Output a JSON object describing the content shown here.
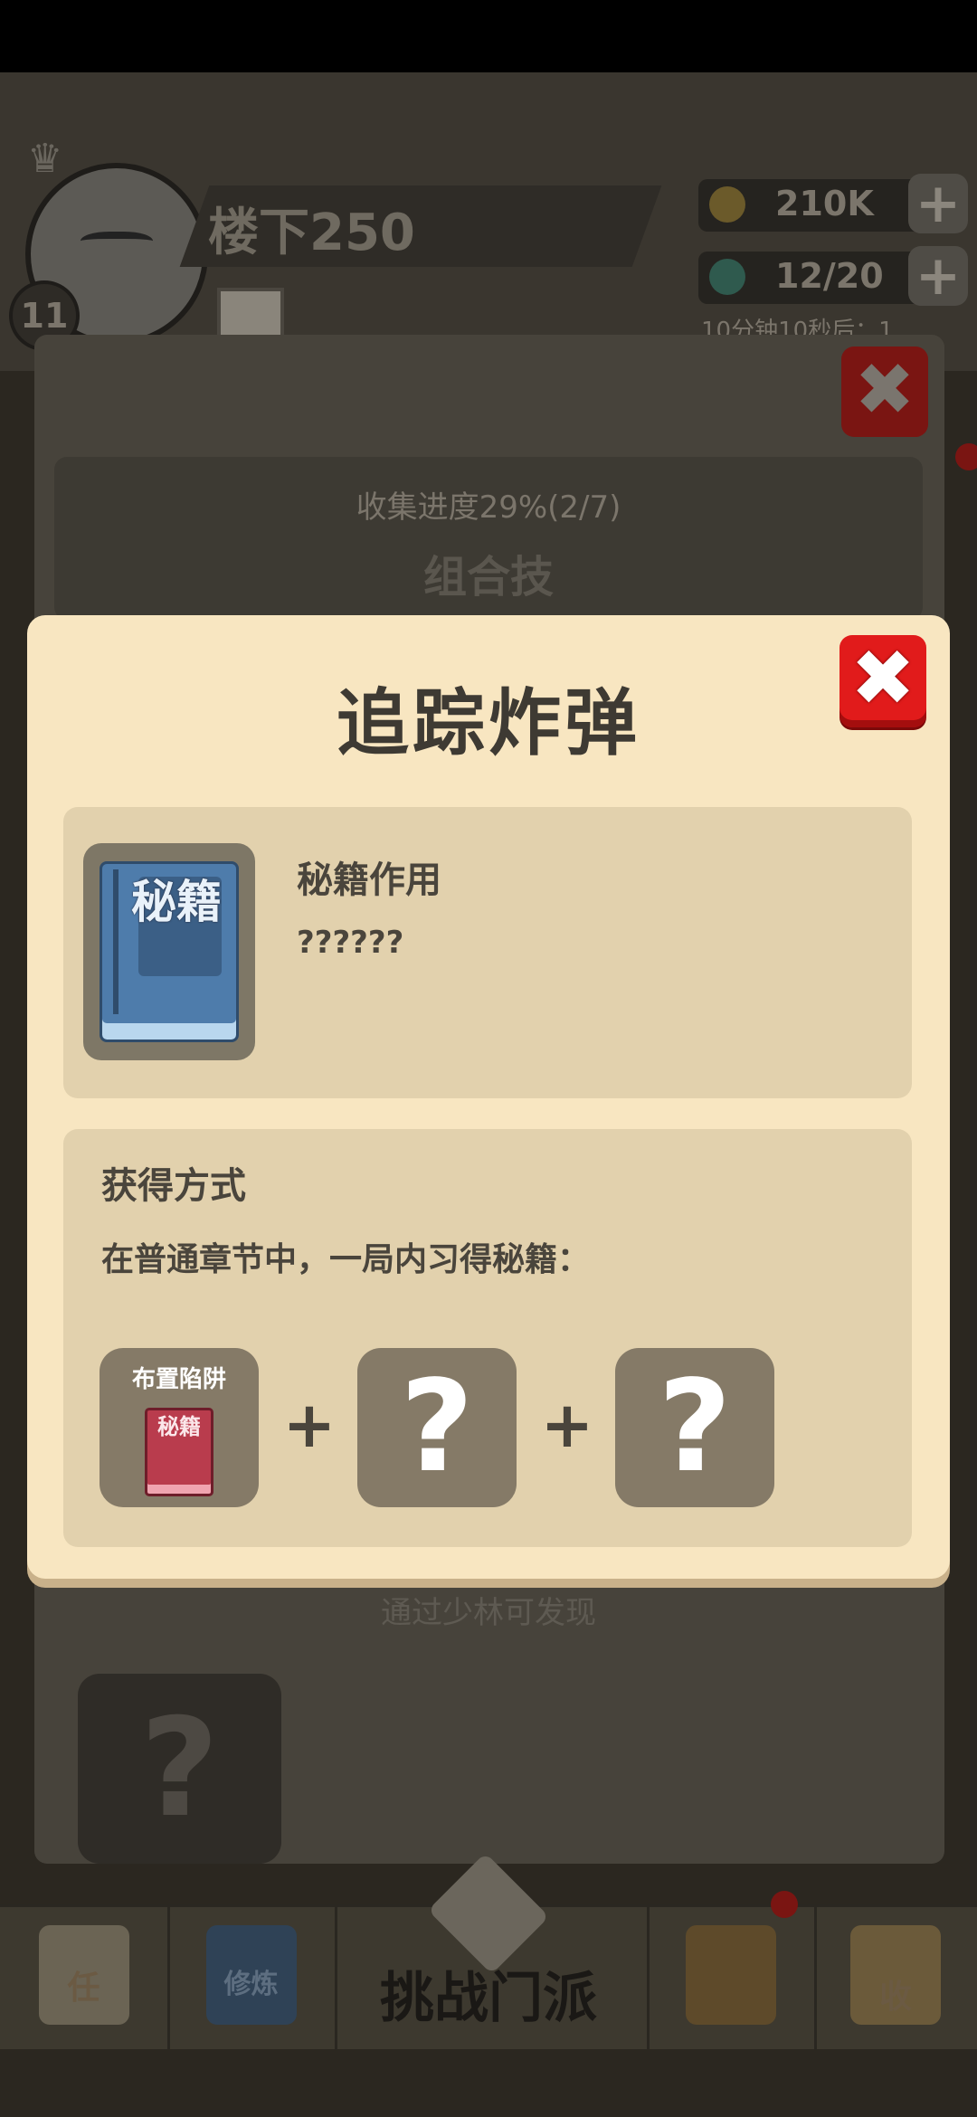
{
  "background": {
    "player": {
      "name": "楼下250",
      "level": "11"
    },
    "resources": [
      {
        "icon": "coin-icon",
        "value": "210K"
      },
      {
        "icon": "gem-icon",
        "value": "12/20"
      }
    ],
    "timer": "10分钟10秒后：1",
    "collection_progress": "收集进度29%(2/7)",
    "section_title": "组合技",
    "discover_hint": "通过少林可发现",
    "locked_symbol": "?",
    "nav": [
      {
        "icon": "task-scroll-icon",
        "label": "任"
      },
      {
        "icon": "training-book-icon",
        "label": "修炼"
      },
      {
        "icon": "crossed-swords-icon",
        "label": "挑战门派"
      },
      {
        "icon": "warrior-helmet-icon",
        "label": ""
      },
      {
        "icon": "collection-chest-icon",
        "label": "收"
      }
    ]
  },
  "modal": {
    "title": "追踪炸弹",
    "close_symbol": "✖",
    "effect": {
      "book_text": "秘籍",
      "title": "秘籍作用",
      "description": "??????"
    },
    "obtain": {
      "title": "获得方式",
      "description": "在普通章节中，一局内习得秘籍：",
      "slots": [
        {
          "label": "布置陷阱",
          "book_text": "秘籍",
          "known": true
        },
        {
          "symbol": "?",
          "known": false
        },
        {
          "symbol": "?",
          "known": false
        }
      ],
      "plus": "+"
    }
  },
  "colors": {
    "modal_bg": "#f8e6c1",
    "card_bg": "#e2d1ad",
    "close_red": "#e11b1b",
    "book_blue": "#4e7cab",
    "book_pink": "#b93c4d",
    "slot_gray": "#857a67"
  }
}
